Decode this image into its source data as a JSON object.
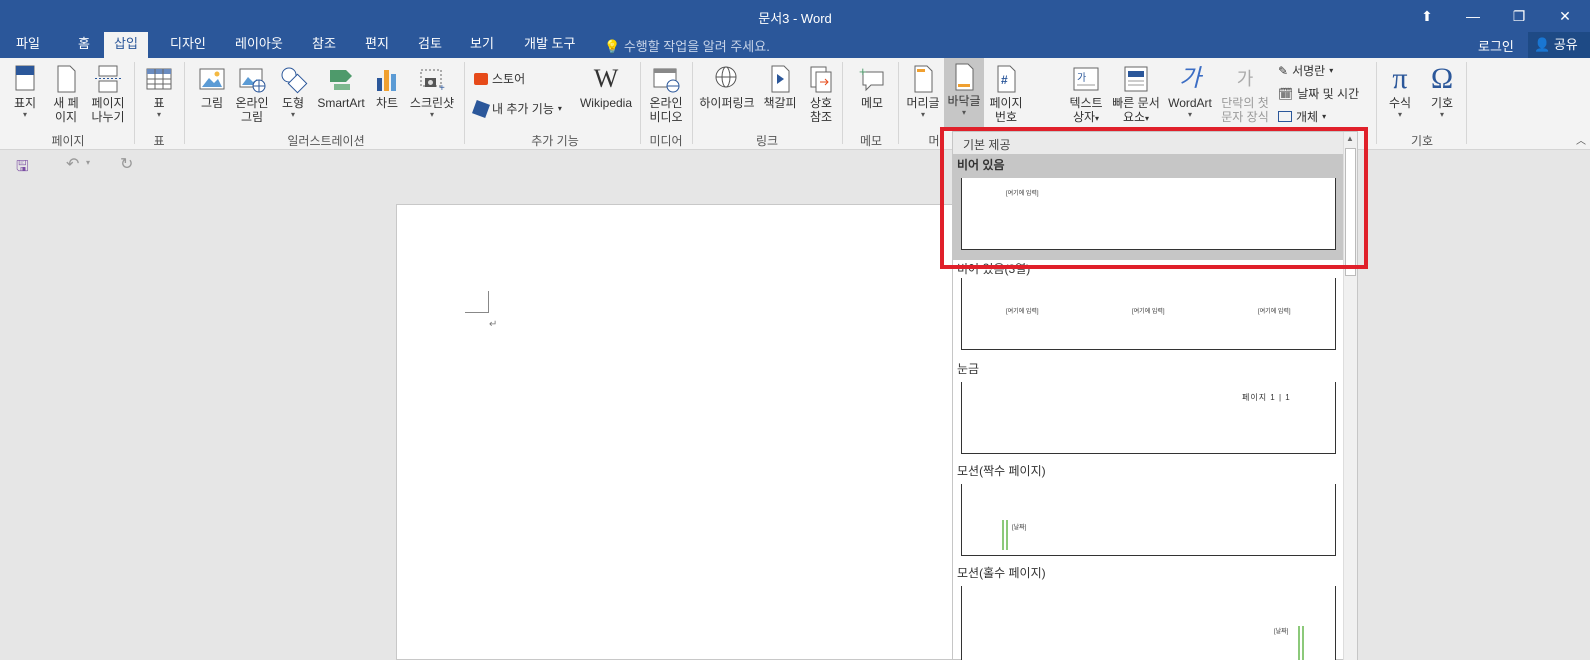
{
  "window": {
    "title": "문서3 - Word",
    "minimize": "—",
    "restore": "❐",
    "close": "✕",
    "ribbon_display": "⬆"
  },
  "tabs": [
    {
      "label": "파일"
    },
    {
      "label": "홈"
    },
    {
      "label": "삽입"
    },
    {
      "label": "디자인"
    },
    {
      "label": "레이아웃"
    },
    {
      "label": "참조"
    },
    {
      "label": "편지"
    },
    {
      "label": "검토"
    },
    {
      "label": "보기"
    },
    {
      "label": "개발 도구"
    }
  ],
  "tell_me": "수행할 작업을 알려 주세요.",
  "login": "로그인",
  "share": "공유",
  "ribbon": {
    "pages": {
      "cover": "표지",
      "new_page_1": "새 페",
      "new_page_2": "이지",
      "break_1": "페이지",
      "break_2": "나누기",
      "group": "페이지"
    },
    "table": {
      "table": "표",
      "group": "표"
    },
    "illustrations": {
      "picture": "그림",
      "online_1": "온라인",
      "online_2": "그림",
      "shapes": "도형",
      "smartart": "SmartArt",
      "chart": "차트",
      "screenshot": "스크린샷",
      "group": "일러스트레이션"
    },
    "addins": {
      "store": "스토어",
      "my_addins": "내 추가 기능",
      "wikipedia": "Wikipedia",
      "group": "추가 기능"
    },
    "media": {
      "video_1": "온라인",
      "video_2": "비디오",
      "group": "미디어"
    },
    "links": {
      "hyperlink": "하이퍼링크",
      "bookmark": "책갈피",
      "cross_1": "상호",
      "cross_2": "참조",
      "group": "링크"
    },
    "comments": {
      "comment": "메모",
      "group": "메모"
    },
    "header_footer": {
      "header": "머리글",
      "footer": "바닥글",
      "pagenum_1": "페이지",
      "pagenum_2": "번호",
      "group": "머리"
    },
    "text": {
      "textbox_1": "텍스트",
      "textbox_2": "상자",
      "quick_1": "빠른 문서",
      "quick_2": "요소",
      "wordart": "WordArt",
      "dropcap_1": "단락의 첫",
      "dropcap_2": "문자 장식",
      "signature": "서명란",
      "datetime": "날짜 및 시간",
      "object": "개체"
    },
    "symbols": {
      "equation": "수식",
      "symbol": "기호",
      "group": "기호"
    }
  },
  "gallery": {
    "header": "기본 제공",
    "items": [
      {
        "label": "비어 있음",
        "thumb_texts": [
          "[여기에 입력]"
        ]
      },
      {
        "label": "비어 있음(3열)",
        "thumb_texts": [
          "[여기에 입력]",
          "[여기에 입력]",
          "[여기에 입력]"
        ]
      },
      {
        "label": "눈금",
        "thumb_texts": [
          "페이지 1 | 1"
        ]
      },
      {
        "label": "모션(짝수 페이지)",
        "thumb_texts": [
          "[날짜]"
        ]
      },
      {
        "label": "모션(홀수 페이지)",
        "thumb_texts": [
          "[날짜]"
        ]
      }
    ]
  },
  "colors": {
    "brand": "#2b579a",
    "highlight": "#e0202a"
  }
}
